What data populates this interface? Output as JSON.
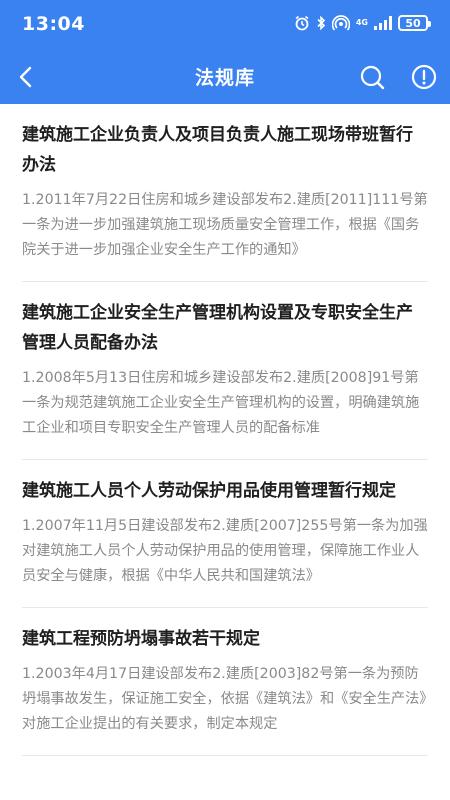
{
  "status_bar": {
    "time": "13:04",
    "network": "4G",
    "battery": "50",
    "icons": [
      "alarm-icon",
      "bluetooth-icon",
      "hotspot-icon",
      "signal-icon",
      "battery-icon"
    ]
  },
  "app_bar": {
    "title": "法规库",
    "icons": [
      "back-arrow-icon",
      "search-icon",
      "info-icon"
    ],
    "color": "#3a82f0"
  },
  "laws": [
    {
      "title": "建筑施工企业负责人及项目负责人施工现场带班暂行办法",
      "summary": "1.2011年7月22日住房和城乡建设部发布2.建质[2011]111号第一条为进一步加强建筑施工现场质量安全管理工作，根据《国务院关于进一步加强企业安全生产工作的通知》"
    },
    {
      "title": "建筑施工企业安全生产管理机构设置及专职安全生产管理人员配备办法",
      "summary": "1.2008年5月13日住房和城乡建设部发布2.建质[2008]91号第一条为规范建筑施工企业安全生产管理机构的设置，明确建筑施工企业和项目专职安全生产管理人员的配备标准"
    },
    {
      "title": "建筑施工人员个人劳动保护用品使用管理暂行规定",
      "summary": "1.2007年11月5日建设部发布2.建质[2007]255号第一条为加强对建筑施工人员个人劳动保护用品的使用管理，保障施工作业人员安全与健康，根据《中华人民共和国建筑法》"
    },
    {
      "title": "建筑工程预防坍塌事故若干规定",
      "summary": "1.2003年4月17日建设部发布2.建质[2003]82号第一条为预防坍塌事故发生，保证施工安全，依据《建筑法》和《安全生产法》对施工企业提出的有关要求，制定本规定"
    }
  ]
}
